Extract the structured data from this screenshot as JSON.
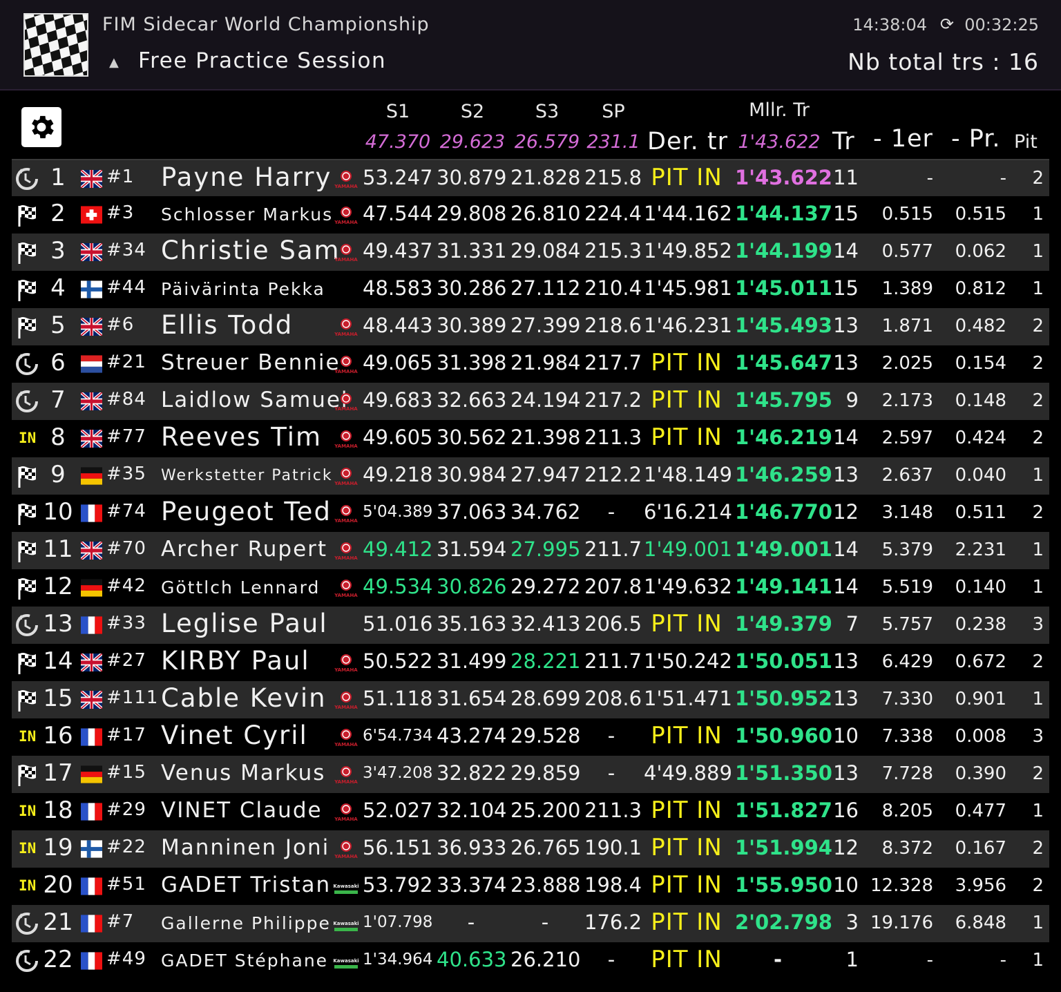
{
  "header": {
    "championship": "FIM Sidecar World Championship",
    "session": "Free Practice Session",
    "clock": "14:38:04",
    "timer": "00:32:25",
    "total_laps": "Nb total trs : 16",
    "logo_icon": "checkered-flag-logo",
    "session_icon": "warning-icon",
    "timer_icon": "timer-icon"
  },
  "columns": {
    "s1": "S1",
    "s2": "S2",
    "s3": "S3",
    "sp": "SP",
    "last": "Der. tr",
    "best": "Mllr. Tr",
    "laps": "Tr",
    "gap_first": "- 1er",
    "gap_prev": "- Pr.",
    "pit": "Pit"
  },
  "best": {
    "s1": "47.370",
    "s2": "29.623",
    "s3": "26.579",
    "sp": "231.1",
    "lap": "1'43.622"
  },
  "colors": {
    "purple": "#d46cd6",
    "green": "#2fe38a",
    "yellow": "#f7ef1a",
    "alt_row": "#2a2a2a"
  },
  "rows": [
    {
      "status": "pit",
      "pos": "1",
      "flag": "gb",
      "num": "#1",
      "name": "Payne Harry",
      "size": "big",
      "brand": "yamaha",
      "s1": "53.247",
      "s2": "30.879",
      "s3": "21.828",
      "sp": "215.8",
      "last": "PIT IN",
      "best": "1'43.622",
      "best_c": "purple",
      "laps": "11",
      "gap1": "-",
      "gapp": "-",
      "pit": "2"
    },
    {
      "status": "flag",
      "pos": "2",
      "flag": "ch",
      "num": "#3",
      "name": "Schlosser Markus",
      "size": "sm",
      "brand": "yamaha",
      "s1": "47.544",
      "s2": "29.808",
      "s3": "26.810",
      "sp": "224.4",
      "last": "1'44.162",
      "best": "1'44.137",
      "laps": "15",
      "gap1": "0.515",
      "gapp": "0.515",
      "pit": "1"
    },
    {
      "status": "flag",
      "pos": "3",
      "flag": "gb",
      "num": "#34",
      "name": "Christie Sam",
      "size": "big",
      "brand": "yamaha",
      "s1": "49.437",
      "s2": "31.331",
      "s3": "29.084",
      "sp": "215.3",
      "last": "1'49.852",
      "best": "1'44.199",
      "laps": "14",
      "gap1": "0.577",
      "gapp": "0.062",
      "pit": "1"
    },
    {
      "status": "flag",
      "pos": "4",
      "flag": "fi",
      "num": "#44",
      "name": "Päivärinta Pekka",
      "size": "sm",
      "brand": "",
      "s1": "48.583",
      "s2": "30.286",
      "s3": "27.112",
      "sp": "210.4",
      "last": "1'45.981",
      "best": "1'45.011",
      "laps": "15",
      "gap1": "1.389",
      "gapp": "0.812",
      "pit": "1"
    },
    {
      "status": "flag",
      "pos": "5",
      "flag": "gb",
      "num": "#6",
      "name": "Ellis Todd",
      "size": "big",
      "brand": "yamaha",
      "s1": "48.443",
      "s2": "30.389",
      "s3": "27.399",
      "sp": "218.6",
      "last": "1'46.231",
      "best": "1'45.493",
      "laps": "13",
      "gap1": "1.871",
      "gapp": "0.482",
      "pit": "2"
    },
    {
      "status": "pit",
      "pos": "6",
      "flag": "nl",
      "num": "#21",
      "name": "Streuer Bennie",
      "size": "med",
      "brand": "yamaha",
      "s1": "49.065",
      "s2": "31.398",
      "s3": "21.984",
      "sp": "217.7",
      "last": "PIT IN",
      "best": "1'45.647",
      "laps": "13",
      "gap1": "2.025",
      "gapp": "0.154",
      "pit": "2"
    },
    {
      "status": "pit",
      "pos": "7",
      "flag": "gb",
      "num": "#84",
      "name": "Laidlow Samuel",
      "size": "med",
      "brand": "yamaha",
      "s1": "49.683",
      "s2": "32.663",
      "s3": "24.194",
      "sp": "217.2",
      "last": "PIT IN",
      "best": "1'45.795",
      "laps": "9",
      "gap1": "2.173",
      "gapp": "0.148",
      "pit": "2"
    },
    {
      "status": "in",
      "pos": "8",
      "flag": "gb",
      "num": "#77",
      "name": "Reeves Tim",
      "size": "big",
      "brand": "yamaha",
      "s1": "49.605",
      "s2": "30.562",
      "s3": "21.398",
      "sp": "211.3",
      "last": "PIT IN",
      "best": "1'46.219",
      "laps": "14",
      "gap1": "2.597",
      "gapp": "0.424",
      "pit": "2"
    },
    {
      "status": "flag",
      "pos": "9",
      "flag": "de",
      "num": "#35",
      "name": "Werkstetter Patrick",
      "size": "xs",
      "brand": "yamaha",
      "s1": "49.218",
      "s2": "30.984",
      "s3": "27.947",
      "sp": "212.2",
      "last": "1'48.149",
      "best": "1'46.259",
      "laps": "13",
      "gap1": "2.637",
      "gapp": "0.040",
      "pit": "1"
    },
    {
      "status": "flag",
      "pos": "10",
      "flag": "fr",
      "num": "#74",
      "name": "Peugeot Ted",
      "size": "big",
      "brand": "yamaha",
      "s1": "5'04.389",
      "s1_small": true,
      "s2": "37.063",
      "s3": "34.762",
      "sp": "-",
      "last": "6'16.214",
      "best": "1'46.770",
      "laps": "12",
      "gap1": "3.148",
      "gapp": "0.511",
      "pit": "2"
    },
    {
      "status": "flag",
      "pos": "11",
      "flag": "gb",
      "num": "#70",
      "name": "Archer Rupert",
      "size": "med",
      "brand": "yamaha",
      "s1": "49.412",
      "s1_c": "green",
      "s2": "31.594",
      "s3": "27.995",
      "s3_c": "green",
      "sp": "211.7",
      "last": "1'49.001",
      "last_c": "green",
      "best": "1'49.001",
      "laps": "14",
      "gap1": "5.379",
      "gapp": "2.231",
      "pit": "1"
    },
    {
      "status": "flag",
      "pos": "12",
      "flag": "de",
      "num": "#42",
      "name": "Göttlch Lennard",
      "size": "sm",
      "brand": "yamaha",
      "s1": "49.534",
      "s1_c": "green",
      "s2": "30.826",
      "s2_c": "green",
      "s3": "29.272",
      "sp": "207.8",
      "last": "1'49.632",
      "best": "1'49.141",
      "laps": "14",
      "gap1": "5.519",
      "gapp": "0.140",
      "pit": "1"
    },
    {
      "status": "pit",
      "pos": "13",
      "flag": "fr",
      "num": "#33",
      "name": "Leglise Paul",
      "size": "big",
      "brand": "",
      "s1": "51.016",
      "s2": "35.163",
      "s3": "32.413",
      "sp": "206.5",
      "last": "PIT IN",
      "best": "1'49.379",
      "laps": "7",
      "gap1": "5.757",
      "gapp": "0.238",
      "pit": "3"
    },
    {
      "status": "flag",
      "pos": "14",
      "flag": "gb",
      "num": "#27",
      "name": "KIRBY Paul",
      "size": "big",
      "brand": "yamaha",
      "s1": "50.522",
      "s2": "31.499",
      "s3": "28.221",
      "s3_c": "green",
      "sp": "211.7",
      "last": "1'50.242",
      "best": "1'50.051",
      "laps": "13",
      "gap1": "6.429",
      "gapp": "0.672",
      "pit": "2"
    },
    {
      "status": "flag",
      "pos": "15",
      "flag": "gb",
      "num": "#111",
      "name": "Cable Kevin",
      "size": "big",
      "brand": "yamaha",
      "s1": "51.118",
      "s2": "31.654",
      "s3": "28.699",
      "sp": "208.6",
      "last": "1'51.471",
      "best": "1'50.952",
      "laps": "13",
      "gap1": "7.330",
      "gapp": "0.901",
      "pit": "1"
    },
    {
      "status": "in",
      "pos": "16",
      "flag": "fr",
      "num": "#17",
      "name": "Vinet Cyril",
      "size": "big",
      "brand": "yamaha",
      "s1": "6'54.734",
      "s1_small": true,
      "s2": "43.274",
      "s3": "29.528",
      "sp": "-",
      "last": "PIT IN",
      "best": "1'50.960",
      "laps": "10",
      "gap1": "7.338",
      "gapp": "0.008",
      "pit": "3"
    },
    {
      "status": "flag",
      "pos": "17",
      "flag": "de",
      "num": "#15",
      "name": "Venus Markus",
      "size": "med",
      "brand": "yamaha",
      "s1": "3'47.208",
      "s1_small": true,
      "s2": "32.822",
      "s3": "29.859",
      "sp": "-",
      "last": "4'49.889",
      "best": "1'51.350",
      "laps": "13",
      "gap1": "7.728",
      "gapp": "0.390",
      "pit": "2"
    },
    {
      "status": "in",
      "pos": "18",
      "flag": "fr",
      "num": "#29",
      "name": "VINET Claude",
      "size": "med",
      "brand": "yamaha",
      "s1": "52.027",
      "s2": "32.104",
      "s3": "25.200",
      "sp": "211.3",
      "last": "PIT IN",
      "best": "1'51.827",
      "laps": "16",
      "gap1": "8.205",
      "gapp": "0.477",
      "pit": "1"
    },
    {
      "status": "in",
      "pos": "19",
      "flag": "fi",
      "num": "#22",
      "name": "Manninen Joni",
      "size": "med",
      "brand": "yamaha",
      "s1": "56.151",
      "s2": "36.933",
      "s3": "26.765",
      "sp": "190.1",
      "last": "PIT IN",
      "best": "1'51.994",
      "laps": "12",
      "gap1": "8.372",
      "gapp": "0.167",
      "pit": "2"
    },
    {
      "status": "in",
      "pos": "20",
      "flag": "fr",
      "num": "#51",
      "name": "GADET Tristan",
      "size": "med",
      "brand": "kawasaki",
      "s1": "53.792",
      "s2": "33.374",
      "s3": "23.888",
      "sp": "198.4",
      "last": "PIT IN",
      "best": "1'55.950",
      "laps": "10",
      "gap1": "12.328",
      "gapp": "3.956",
      "pit": "2"
    },
    {
      "status": "pit",
      "pos": "21",
      "flag": "fr",
      "num": "#7",
      "name": "Gallerne Philippe",
      "size": "sm",
      "brand": "kawasaki",
      "s1": "1'07.798",
      "s1_small": true,
      "s2": "-",
      "s3": "-",
      "sp": "176.2",
      "last": "PIT IN",
      "best": "2'02.798",
      "laps": "3",
      "gap1": "19.176",
      "gapp": "6.848",
      "pit": "1"
    },
    {
      "status": "pit",
      "pos": "22",
      "flag": "fr",
      "num": "#49",
      "name": "GADET Stéphane",
      "size": "sm",
      "brand": "kawasaki",
      "s1": "1'34.964",
      "s1_small": true,
      "s2": "40.633",
      "s2_c": "green",
      "s3": "26.210",
      "sp": "-",
      "last": "PIT IN",
      "best": "-",
      "best_c": "white",
      "laps": "1",
      "gap1": "-",
      "gapp": "-",
      "pit": "1"
    }
  ]
}
